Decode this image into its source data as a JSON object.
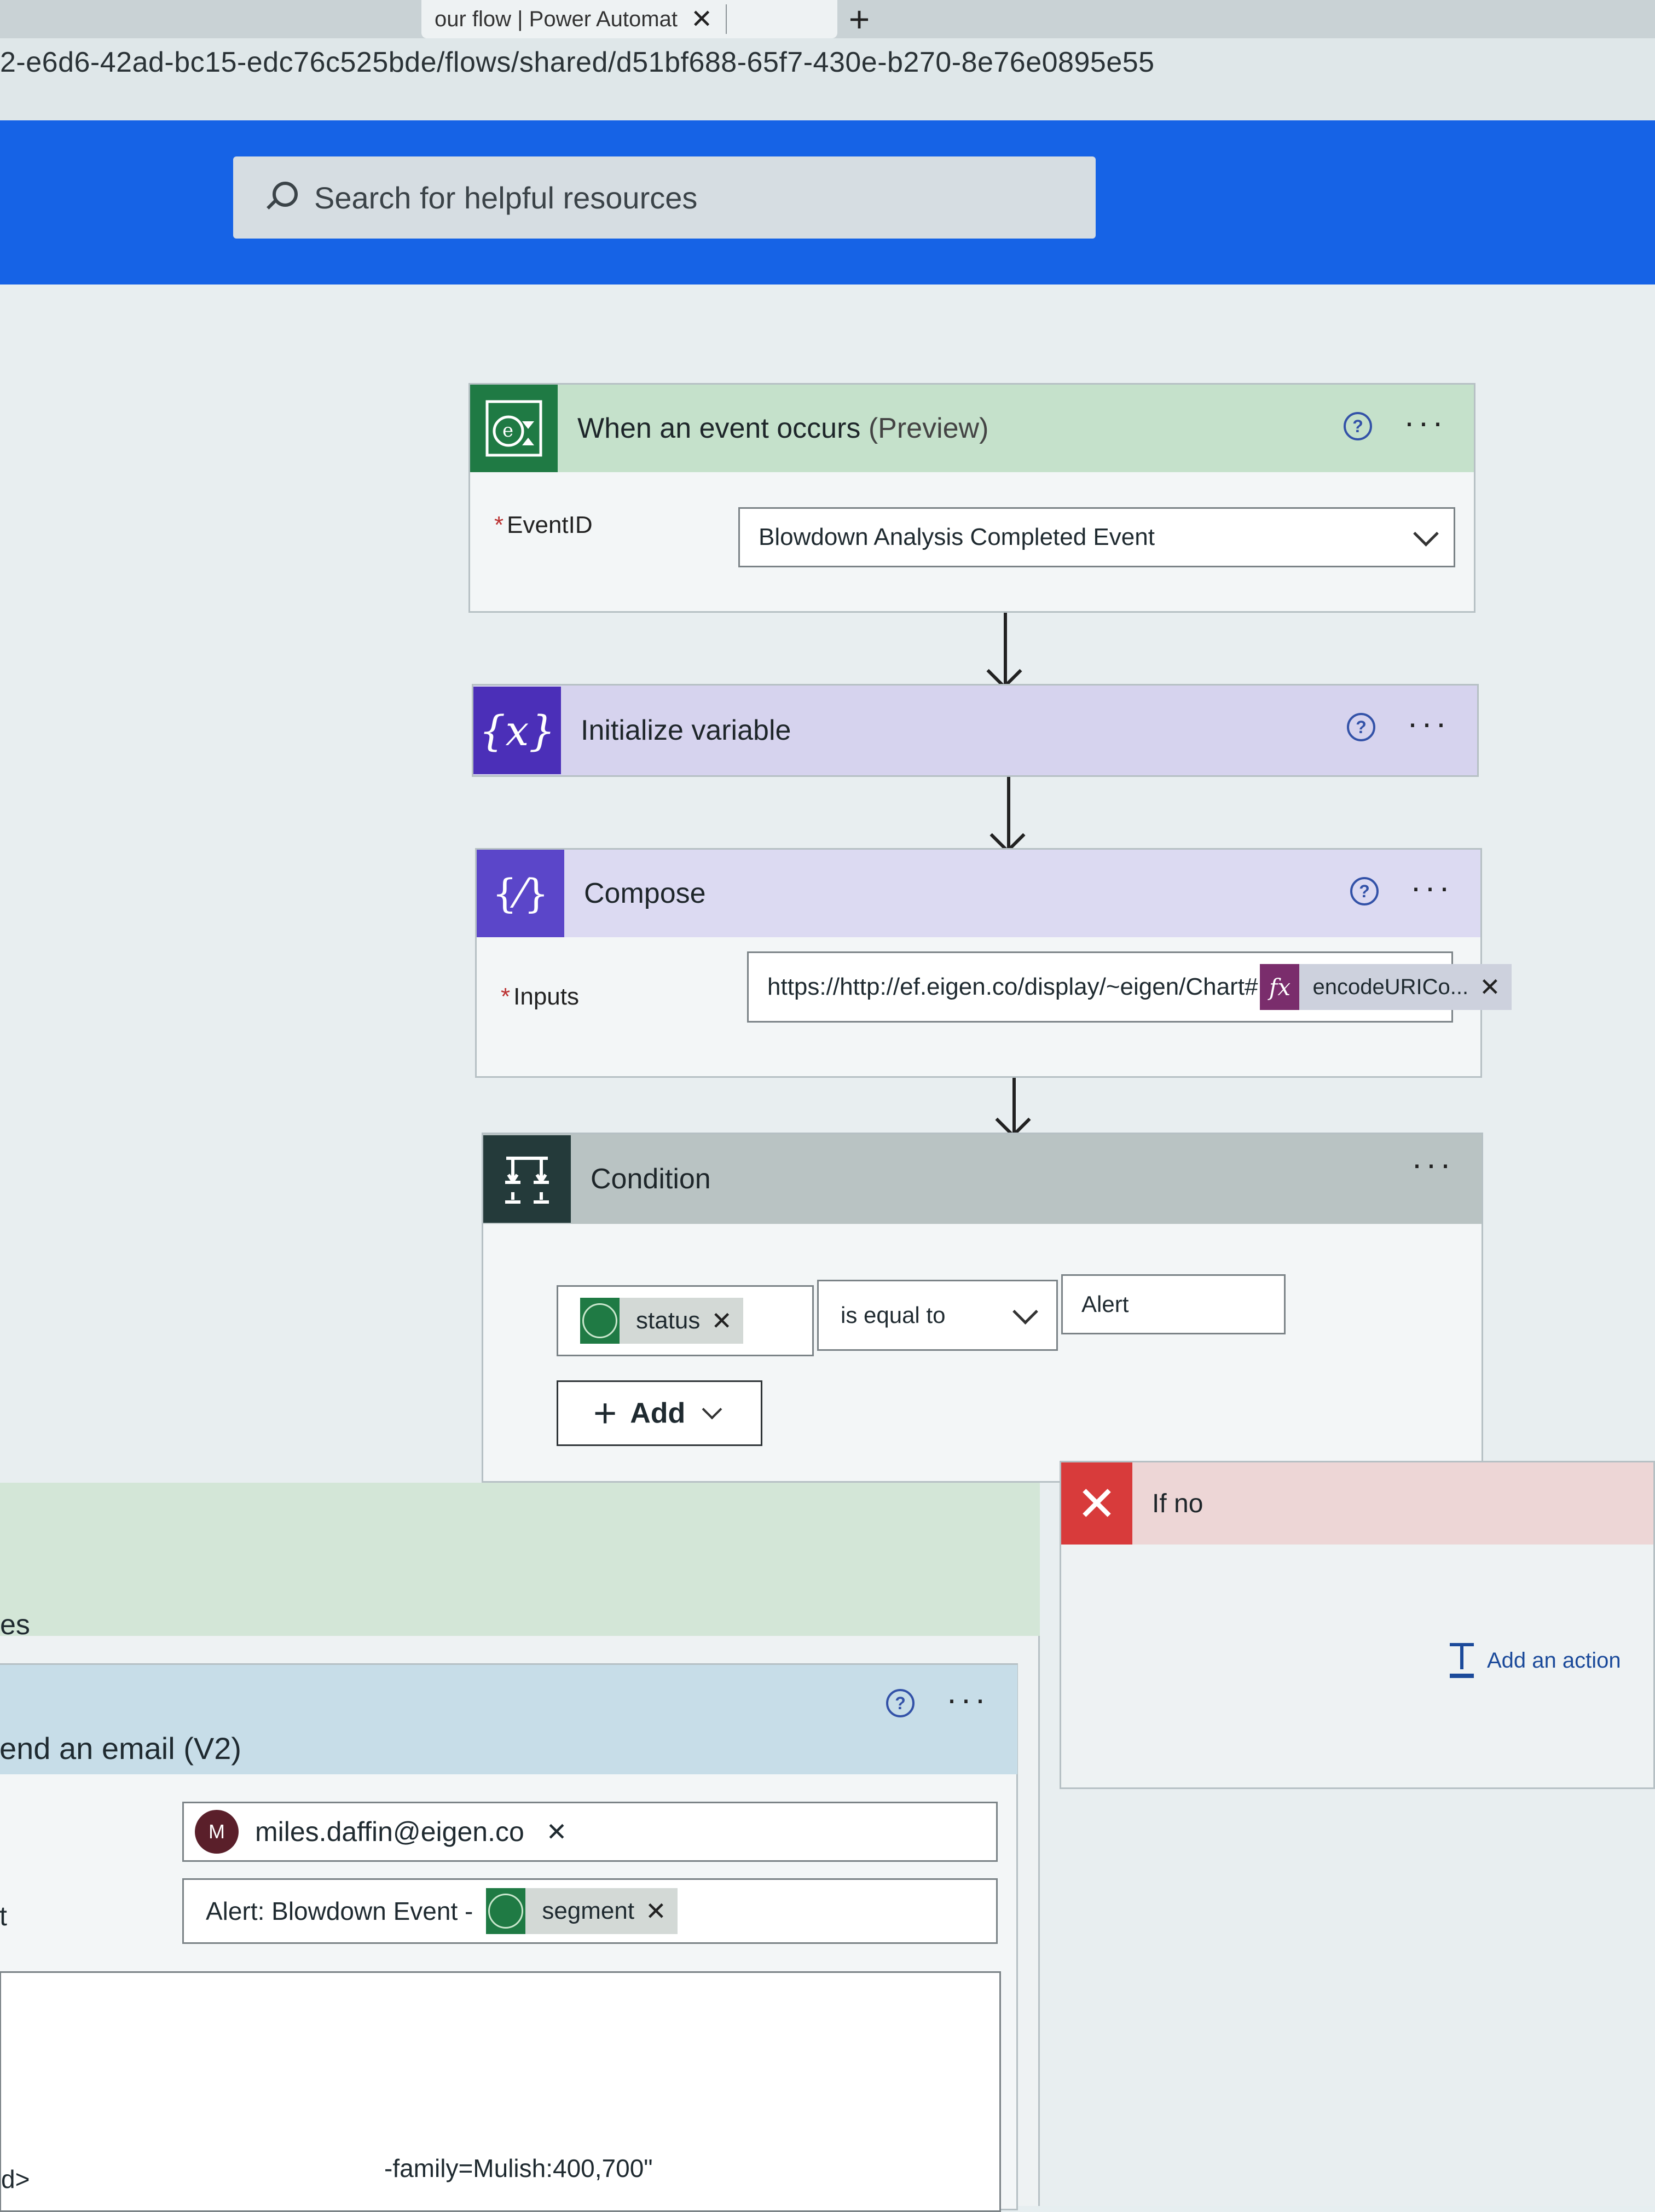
{
  "browser": {
    "tab_title": "our flow | Power Automat",
    "new_tab": "+",
    "url": "2-e6d6-42ad-bc15-edc76c525bde/flows/shared/d51bf688-65f7-430e-b270-8e76e0895e55"
  },
  "header": {
    "search_placeholder": "Search for helpful resources"
  },
  "colors": {
    "brand_blue": "#1663e6",
    "trigger_green": "#1f7a44",
    "variable_purple": "#4b2fb8",
    "compose_purple": "#5b46c9",
    "condition_dark": "#243a3a",
    "if_no_red": "#d83b3b"
  },
  "trigger": {
    "icon": "eigen-event-icon",
    "title": "When an event occurs",
    "title_suffix": "(Preview)",
    "field_label": "EventID",
    "field_value": "Blowdown Analysis Completed Event"
  },
  "init_variable": {
    "icon": "variable-icon",
    "icon_glyph": "{x}",
    "title": "Initialize variable"
  },
  "compose": {
    "icon": "compose-icon",
    "icon_glyph": "{⁄}",
    "title": "Compose",
    "field_label": "Inputs",
    "input_text": "https://http://ef.eigen.co/display/~eigen/Chart#",
    "fx_glyph": "fx",
    "fx_token": "encodeURICo..."
  },
  "condition": {
    "icon": "condition-icon",
    "title": "Condition",
    "operand_token": "status",
    "operator": "is equal to",
    "value": "Alert",
    "add_label": "Add"
  },
  "if_no": {
    "title": "If no",
    "add_action": "Add an action"
  },
  "if_yes": {
    "title_fragment": "es"
  },
  "send_email": {
    "title": "end an email (V2)",
    "to_avatar": "M",
    "to_email": "miles.daffin@eigen.co",
    "subject_prefix": "Alert: Blowdown Event -",
    "subject_token": "segment",
    "body_left_fragment": "t",
    "bottom_fragment_left": "d>",
    "bottom_fragment_text": "-family=Mulish:400,700\""
  }
}
